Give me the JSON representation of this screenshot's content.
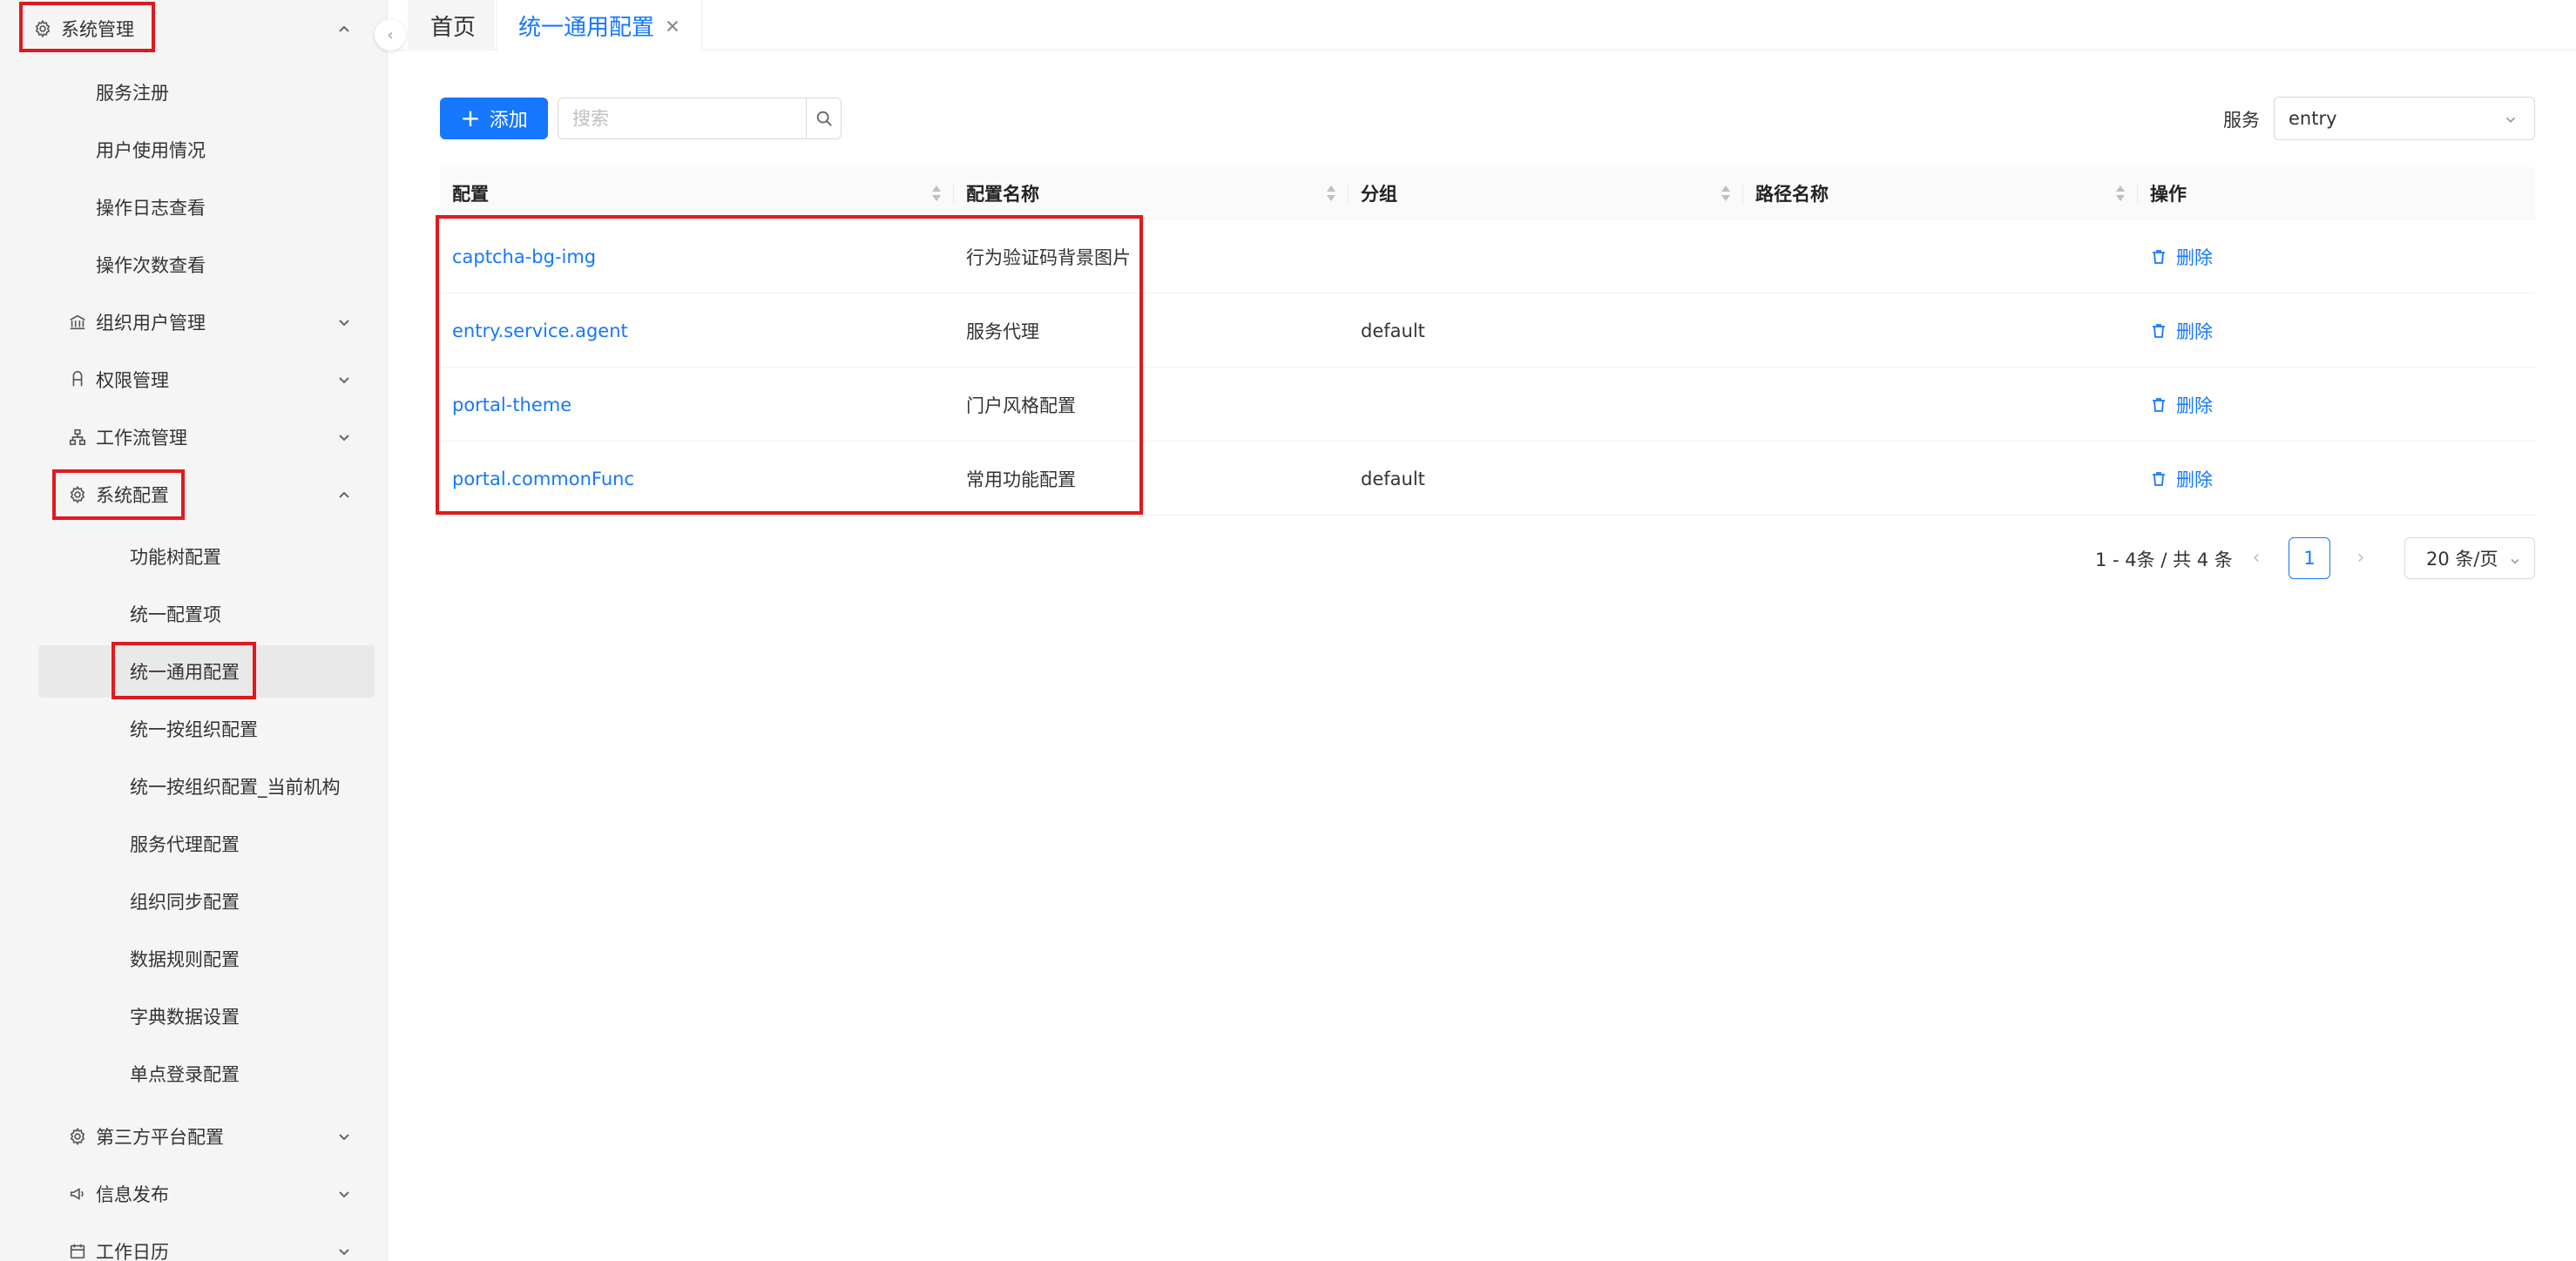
{
  "sidebar": {
    "top": {
      "label": "系统管理",
      "icon": "gear-icon"
    },
    "items": [
      {
        "label": "服务注册"
      },
      {
        "label": "用户使用情况"
      },
      {
        "label": "操作日志查看"
      },
      {
        "label": "操作次数查看"
      },
      {
        "label": "组织用户管理",
        "icon": "bank-icon"
      },
      {
        "label": "权限管理",
        "icon": "user-permission-icon"
      },
      {
        "label": "工作流管理",
        "icon": "workflow-icon"
      },
      {
        "label": "系统配置",
        "icon": "gear-icon"
      }
    ],
    "sub_items": [
      {
        "label": "功能树配置"
      },
      {
        "label": "统一配置项"
      },
      {
        "label": "统一通用配置"
      },
      {
        "label": "统一按组织配置"
      },
      {
        "label": "统一按组织配置_当前机构"
      },
      {
        "label": "服务代理配置"
      },
      {
        "label": "组织同步配置"
      },
      {
        "label": "数据规则配置"
      },
      {
        "label": "字典数据设置"
      },
      {
        "label": "单点登录配置"
      }
    ],
    "bottom_items": [
      {
        "label": "第三方平台配置",
        "icon": "gear-icon"
      },
      {
        "label": "信息发布",
        "icon": "megaphone-icon"
      },
      {
        "label": "工作日历",
        "icon": "calendar-icon"
      }
    ]
  },
  "tabs": [
    {
      "label": "首页"
    },
    {
      "label": "统一通用配置"
    }
  ],
  "toolbar": {
    "add_label": "添加",
    "search_placeholder": "搜索",
    "service_label": "服务",
    "service_value": "entry"
  },
  "table": {
    "columns": [
      "配置",
      "配置名称",
      "分组",
      "路径名称",
      "操作"
    ],
    "rows": [
      {
        "key": "captcha-bg-img",
        "name": "行为验证码背景图片",
        "group": "",
        "path": "",
        "action": "删除"
      },
      {
        "key": "entry.service.agent",
        "name": "服务代理",
        "group": "default",
        "path": "",
        "action": "删除"
      },
      {
        "key": "portal-theme",
        "name": "门户风格配置",
        "group": "",
        "path": "",
        "action": "删除"
      },
      {
        "key": "portal.commonFunc",
        "name": "常用功能配置",
        "group": "default",
        "path": "",
        "action": "删除"
      }
    ]
  },
  "pagination": {
    "total_text": "1 - 4条 / 共 4 条",
    "current_page": "1",
    "page_size": "20 条/页"
  },
  "colors": {
    "primary": "#1677ff",
    "highlight": "#e0191e",
    "sidebar_bg": "#f5f5f5"
  }
}
